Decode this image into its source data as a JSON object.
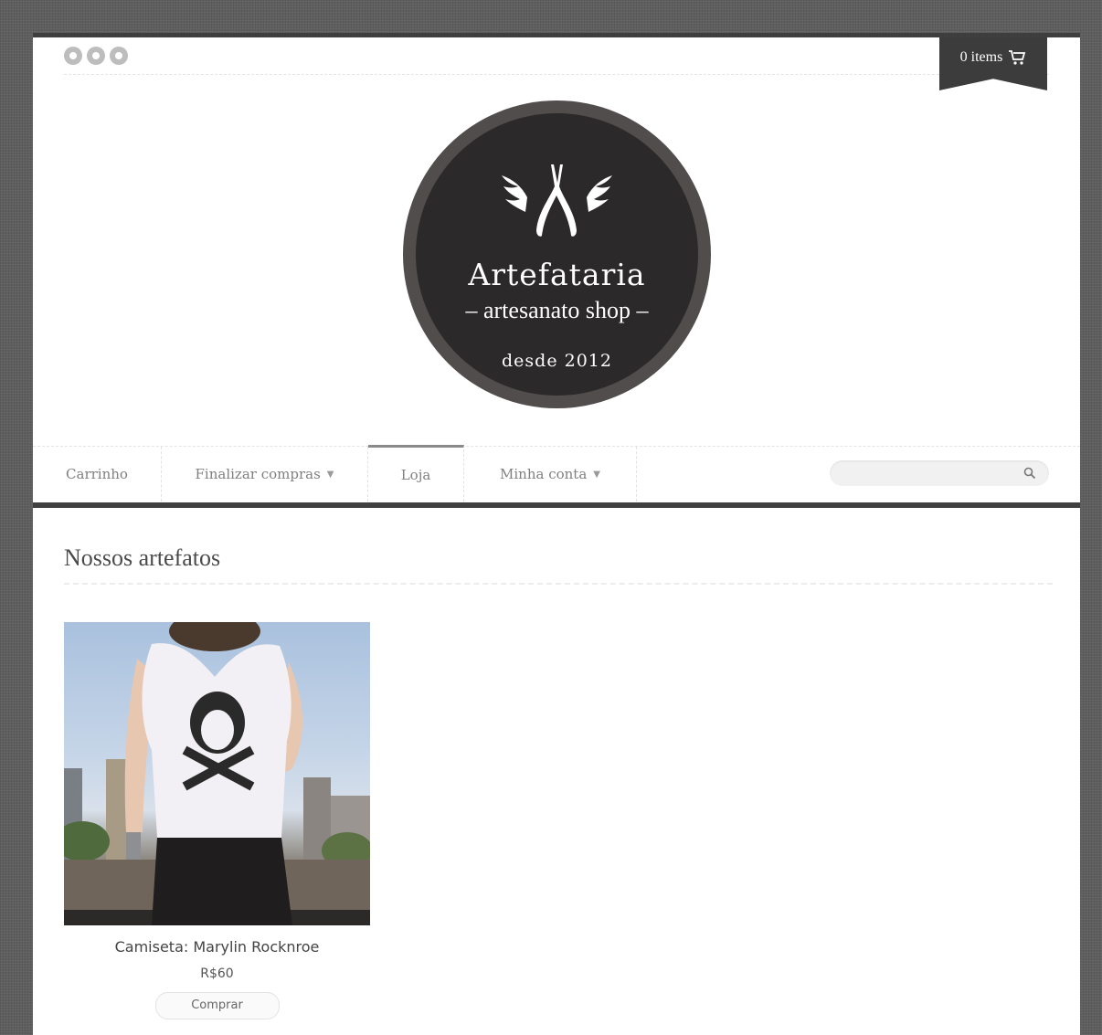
{
  "header": {
    "social_icons": [
      "social-icon-1",
      "social-icon-2",
      "social-icon-3"
    ],
    "cart_label": "0 items",
    "cart_icon": "shopping-cart-icon"
  },
  "logo": {
    "title": "Artefataria",
    "subtitle": "– artesanato shop –",
    "since": "desde 2012",
    "mark_icon": "winged-pliers-icon"
  },
  "nav": {
    "items": [
      {
        "label": "Carrinho",
        "has_dropdown": false,
        "active": false
      },
      {
        "label": "Finalizar compras",
        "has_dropdown": true,
        "active": false
      },
      {
        "label": "Loja",
        "has_dropdown": false,
        "active": true
      },
      {
        "label": "Minha conta",
        "has_dropdown": true,
        "active": false
      }
    ],
    "search_placeholder": "",
    "search_icon": "search-icon"
  },
  "main": {
    "heading": "Nossos artefatos",
    "products": [
      {
        "name": "Camiseta: Marylin Rocknroe",
        "price": "R$60",
        "buy_label": "Comprar"
      }
    ]
  },
  "colors": {
    "frame": "#5e5e5e",
    "dark_accent": "#3c3c3c",
    "logo_bg": "#2b2929",
    "logo_ring": "#524d4d"
  }
}
